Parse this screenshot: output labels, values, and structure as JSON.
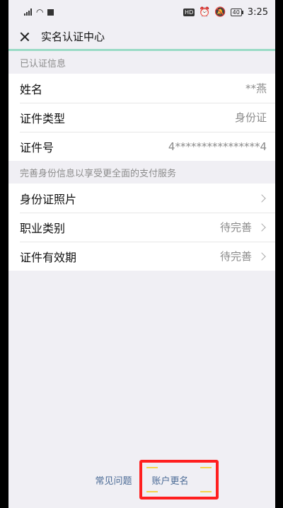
{
  "statusbar": {
    "time": "3:25",
    "battery": "40",
    "hd": "HD"
  },
  "header": {
    "title": "实名认证中心"
  },
  "verified": {
    "section_label": "已认证信息",
    "rows": [
      {
        "label": "姓名",
        "value": "**燕"
      },
      {
        "label": "证件类型",
        "value": "身份证"
      },
      {
        "label": "证件号",
        "value": "4****************4"
      }
    ]
  },
  "complete": {
    "section_label": "完善身份信息以享受更全面的支付服务",
    "rows": [
      {
        "label": "身份证照片",
        "value": ""
      },
      {
        "label": "职业类别",
        "value": "待完善"
      },
      {
        "label": "证件有效期",
        "value": "待完善"
      }
    ]
  },
  "footer": {
    "faq": "常见问题",
    "rename": "账户更名"
  },
  "colors": {
    "accent_line": "#9adbc6",
    "link": "#4a6a95",
    "highlight": "#ff1f1f"
  }
}
